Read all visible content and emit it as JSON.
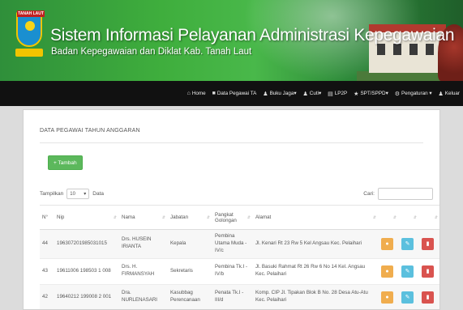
{
  "header": {
    "logo_tag": "TANAH LAUT",
    "title": "Sistem Informasi Pelayanan Administrasi Kepegawaian",
    "subtitle": "Badan Kepegawaian dan Diklat Kab. Tanah Laut"
  },
  "nav": [
    {
      "icon": "home-icon",
      "glyph": "⌂",
      "label": "Home"
    },
    {
      "icon": "data-icon",
      "glyph": "■",
      "label": "Data Pegawai TA"
    },
    {
      "icon": "users-icon",
      "glyph": "♟",
      "label": "Buku Jaga▾"
    },
    {
      "icon": "users-icon",
      "glyph": "♟",
      "label": "Cuti▾"
    },
    {
      "icon": "document-icon",
      "glyph": "▤",
      "label": "LP2P"
    },
    {
      "icon": "star-icon",
      "glyph": "★",
      "label": "SPT/SPPD▾"
    },
    {
      "icon": "gear-icon",
      "glyph": "⚙",
      "label": "Pengaturan ▾"
    },
    {
      "icon": "logout-icon",
      "glyph": "♟",
      "label": "Keluar"
    }
  ],
  "page": {
    "title": "DATA PEGAWAI TAHUN ANGGARAN",
    "add_button": "+ Tambah",
    "show_label": "Tampilkan",
    "show_value": "10",
    "data_label": "Data",
    "search_label": "Cari:",
    "search_value": ""
  },
  "table": {
    "headers": [
      "N°",
      "Nip",
      "Nama",
      "Jabatan",
      "Pangkat Golongan",
      "Alamat",
      "",
      "",
      ""
    ],
    "rows": [
      {
        "no": "44",
        "nip": "196307201985031015",
        "nama": "Drs. HUSEIN IRIANTA",
        "jabatan": "Kepala",
        "pangkat": "Pembina Utama Muda - IV/c",
        "alamat": "Jl. Kenari Rt 23 Rw 5 Kel Angsau Kec. Pelaihari"
      },
      {
        "no": "43",
        "nip": "19611006 198503 1 008",
        "nama": "Drs. H. FIRMANSYAH",
        "jabatan": "Sekretaris",
        "pangkat": "Pembina Tk.I - IV/b",
        "alamat": "Jl. Basuki Rahmat Rt 26 Rw 6 No 14 Kel. Angsau Kec. Pelaihari"
      },
      {
        "no": "42",
        "nip": "19640212 199008 2 001",
        "nama": "Dra. NURLENASARI",
        "jabatan": "Kasubbag Perencanaan",
        "pangkat": "Penata Tk.I - III/d",
        "alamat": "Komp. CIP Jl. Tipakan Blok B No. 28 Desa Atu-Atu Kec. Pelaihari"
      }
    ],
    "actions": {
      "view_glyph": "●",
      "edit_glyph": "✎",
      "delete_glyph": "▮"
    }
  }
}
